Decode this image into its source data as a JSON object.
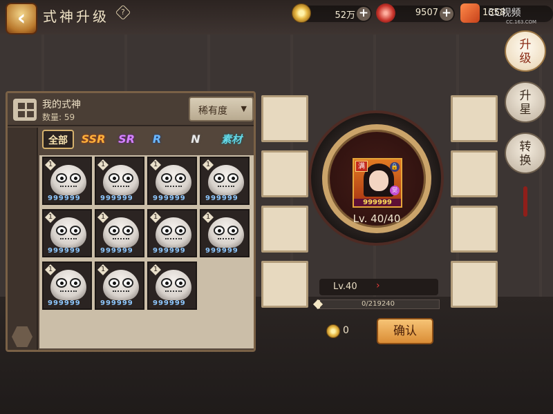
{
  "header": {
    "back_icon": "back-arrow-icon",
    "title": "式神升级",
    "help_icon": "help-icon",
    "resources": [
      {
        "name": "coin",
        "icon": "coin-icon",
        "value": "52万"
      },
      {
        "name": "jade",
        "icon": "magatama-icon",
        "value": "9507"
      },
      {
        "name": "amulet",
        "icon": "amulet-icon",
        "value": "1358"
      }
    ],
    "watermark": "CC视频",
    "watermark_sub": "CC.163.COM"
  },
  "side_tabs": [
    {
      "label": "升级",
      "active": true
    },
    {
      "label": "升星",
      "active": false
    },
    {
      "label": "转换",
      "active": false
    }
  ],
  "left_panel": {
    "title": "我的式神",
    "count_label": "数量: 59",
    "sort_label": "稀有度",
    "filters": [
      "全部",
      "SSR",
      "SR",
      "R",
      "N",
      "素材"
    ],
    "cards": [
      {
        "level": "1",
        "exp": "999999"
      },
      {
        "level": "1",
        "exp": "999999"
      },
      {
        "level": "1",
        "exp": "999999"
      },
      {
        "level": "1",
        "exp": "999999"
      },
      {
        "level": "1",
        "exp": "999999"
      },
      {
        "level": "1",
        "exp": "999999"
      },
      {
        "level": "1",
        "exp": "999999"
      },
      {
        "level": "1",
        "exp": "999999"
      },
      {
        "level": "1",
        "exp": "999999"
      },
      {
        "level": "1",
        "exp": "999999"
      },
      {
        "level": "1",
        "exp": "999999"
      }
    ]
  },
  "main": {
    "badge_full": "满",
    "badge_awake": "觉",
    "lock_icon": "lock-icon",
    "portrait_exp": "999999",
    "level_display": "Lv. 40/40",
    "level_bar": "Lv.40",
    "exp_text": "0/219240",
    "exp_progress": 0.02,
    "cost_value": "0",
    "confirm_label": "确认"
  }
}
